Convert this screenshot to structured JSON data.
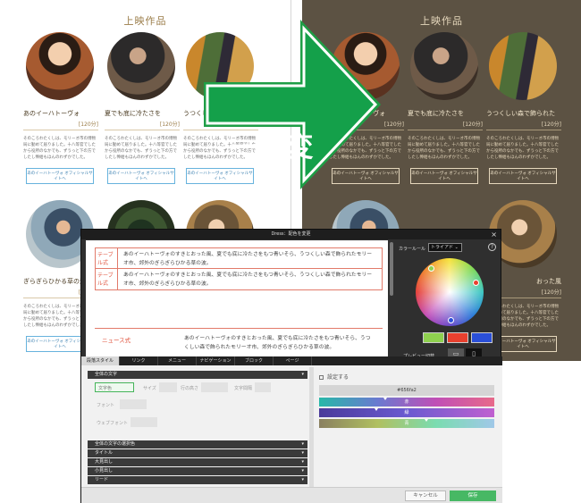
{
  "section_title": "上映作品",
  "cards": [
    {
      "title": "あのイーハトーヴォ",
      "count": "[120分]",
      "desc": "そのころわたくしは、モリーオ市の博物局に勤めて居りました。十八等官でしたから役所のなかでも、ずうっと下の方でしたし俸給もほんのわずかでした。",
      "button": "あのイーハトーヴォ オフィシャルサイトへ"
    },
    {
      "title": "夏でも底に冷たさを",
      "count": "[120分]",
      "desc": "そのころわたくしは、モリーオ市の博物局に勤めて居りました。十八等官でしたから役所のなかでも、ずうっと下の方でしたし俸給もほんのわずかでした。",
      "button": "あのイーハトーヴォ オフィシャルサイトへ"
    },
    {
      "title": "うつくしい森で飾られた",
      "count": "[120分]",
      "desc": "そのころわたくしは、モリーオ市の博物局に勤めて居りました。十八等官でしたから役所のなかでも、ずうっと下の方でしたし俸給もほんのわずかでした。",
      "button": "あのイーハトーヴォ オフィシャルサイトへ"
    },
    {
      "title": "ぎらぎらひかる草の波",
      "count": "[120分]",
      "desc": "そのころわたくしは、モリーオ市の博物局に勤めて居りました。十八等官でしたから役所のなかでも、ずうっと下の方でしたし俸給もほんのわずかでした。",
      "button": "あのイーハトーヴォ オフィシャルサイトへ"
    },
    {
      "title": "",
      "count": "",
      "desc": "",
      "button": ""
    },
    {
      "title": "おった風",
      "count": "[120分]",
      "desc": "そのころわたくしは、モリーオ市の博物局に勤めて居りました。十八等官でしたから役所のなかでも、ずうっと下の方でしたし俸給もほんのわずかでした。",
      "button": "あのイーハトーヴォ オフィシャルサイトへ"
    }
  ],
  "arrow_label": "一括変換",
  "dialog": {
    "title": "Dress：配色を変更",
    "close_icon": "×",
    "preview": {
      "table_head": "テーブル式",
      "table_text": "あのイーハトーヴォのすきとおった風、夏でも底に冷たさをもつ青いそら、うつくしい森で飾られたモリーオ市、郊外のぎらぎらひかる草の波。",
      "news_label": "ニュース式",
      "news_text": "あのイーハトーヴォのすきとおった風、夏でも底に冷たさをもつ青いそら、うつくしい森で飾られたモリーオ市、郊外のぎらぎらひかる草の波。"
    },
    "color_rule_label": "カラールール",
    "color_rule_value": "トライアド ⌄",
    "help_icon": "?",
    "preview_switch_label": "プレビュー切替",
    "desktop_icon": "▭",
    "mobile_icon": "▯",
    "swatches": [
      "#8fd14f",
      "#e8402e",
      "#2a4fd8"
    ],
    "wheel_handles": [
      "#8fd14f",
      "#e8402e",
      "#2a4fd8"
    ],
    "tabs": [
      "段落スタイル",
      "リンク",
      "メニュー",
      "ナビゲーション",
      "ブロック",
      "ページ"
    ],
    "sections": {
      "global_text": "全体の文字",
      "global_select": "全体の文字の選択色",
      "title": "タイトル",
      "h_large": "大見出し",
      "h_small": "小見出し",
      "lead": "リード"
    },
    "fields": {
      "text_color": "文字色",
      "size": "サイズ",
      "line_height": "行の高さ",
      "letter_spacing": "文字間隔",
      "font": "フォント",
      "web_font": "ウェブフォント"
    },
    "settings_label": "設定する",
    "hex_value": "#656fa2",
    "slider_hue": "赤",
    "slider_sat": "緑",
    "slider_light": "青",
    "cancel_label": "キャンセル",
    "save_label": "保存"
  }
}
